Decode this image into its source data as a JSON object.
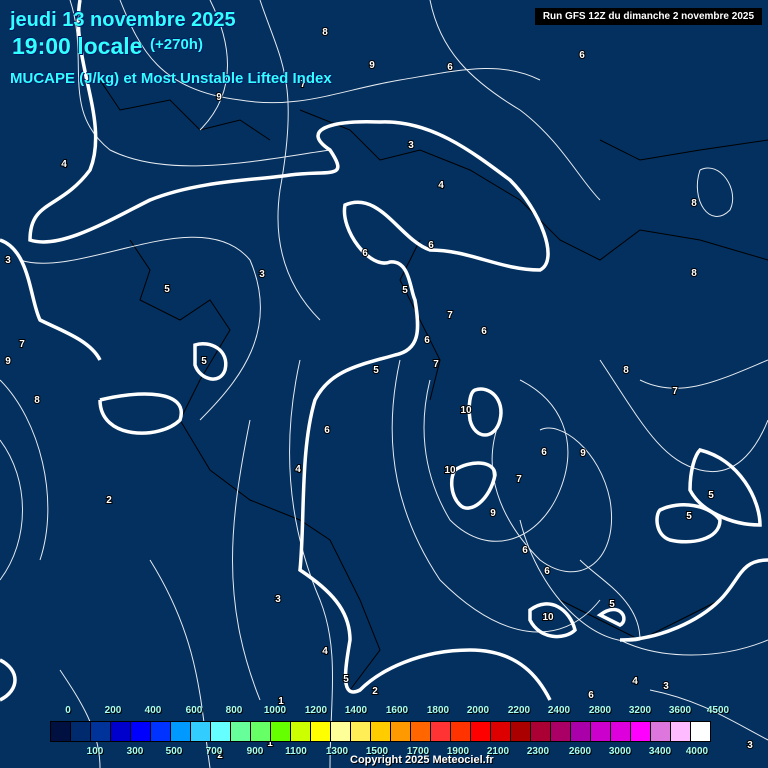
{
  "header": {
    "date": "jeudi 13 novembre 2025",
    "time": "19:00 locale",
    "lead": "(+270h)",
    "parameter": "MUCAPE (J/kg) et Most Unstable Lifted Index",
    "run": "Run GFS 12Z du dimanche 2 novembre 2025"
  },
  "legend": {
    "top_labels": [
      "0",
      "200",
      "400",
      "600",
      "800",
      "1000",
      "1200",
      "1400",
      "1600",
      "1800",
      "2000",
      "2200",
      "2400",
      "2800",
      "3200",
      "3600",
      "4500"
    ],
    "bottom_labels": [
      "100",
      "300",
      "500",
      "700",
      "900",
      "1100",
      "1300",
      "1500",
      "1700",
      "1900",
      "2100",
      "2300",
      "2600",
      "3000",
      "3400",
      "4000"
    ],
    "colors": [
      "#001040",
      "#002a6e",
      "#003399",
      "#0000cc",
      "#0000ff",
      "#0033ff",
      "#0099ff",
      "#33ccff",
      "#66ffff",
      "#66ff99",
      "#66ff66",
      "#66ff00",
      "#ccff00",
      "#ffff00",
      "#ffff99",
      "#ffee55",
      "#ffcc00",
      "#ff9900",
      "#ff6600",
      "#ff3333",
      "#ff3300",
      "#ff0000",
      "#dd0000",
      "#aa0000",
      "#aa0033",
      "#aa0066",
      "#aa00aa",
      "#cc00cc",
      "#dd00dd",
      "#ff00ff",
      "#dd77dd",
      "#ffbbff",
      "#ffffff"
    ]
  },
  "contour_labels": [
    "8",
    "9",
    "6",
    "6",
    "7",
    "9",
    "4",
    "3",
    "4",
    "8",
    "6",
    "6",
    "3",
    "5",
    "5",
    "8",
    "5",
    "7",
    "7",
    "6",
    "5",
    "6",
    "7",
    "9",
    "8",
    "10",
    "8",
    "7",
    "9",
    "6",
    "6",
    "10",
    "9",
    "7",
    "6",
    "4",
    "5",
    "5",
    "2",
    "6",
    "5",
    "3",
    "10",
    "4",
    "5",
    "2",
    "6",
    "4",
    "3",
    "3",
    "1",
    "1",
    "2",
    "3"
  ],
  "copyright": "Copyright 2025 Meteociel.fr"
}
